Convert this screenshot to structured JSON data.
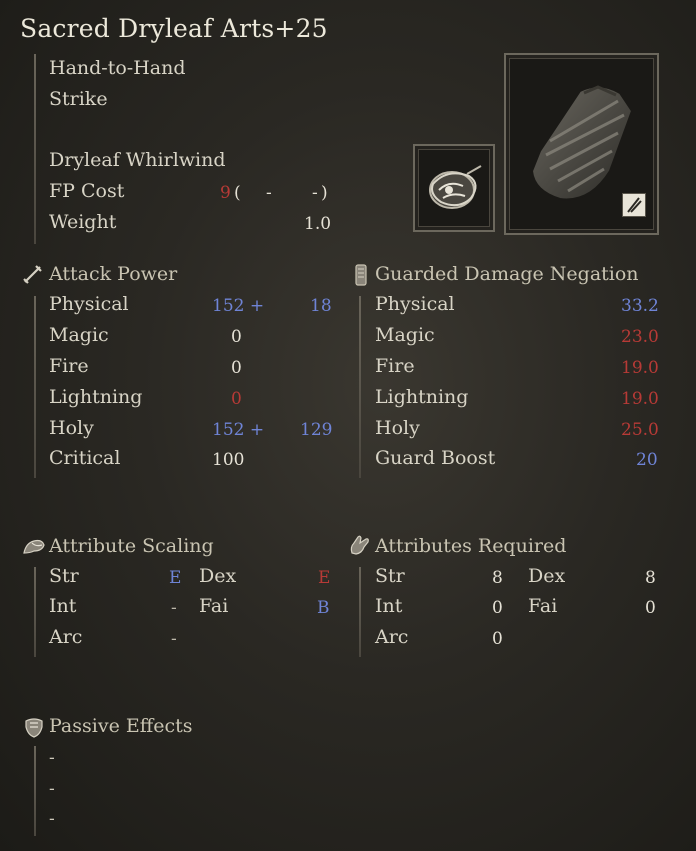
{
  "title": "Sacred Dryleaf Arts+25",
  "weapon": {
    "type": "Hand-to-Hand",
    "attack_type": "Strike",
    "skill": "Dryleaf Whirlwind",
    "fp_label": "FP Cost",
    "fp_value": "9",
    "fp_open": "(",
    "fp_dash1": "-",
    "fp_dash2": "-",
    "fp_close": ")",
    "weight_label": "Weight",
    "weight_value": "1.0"
  },
  "attack_power": {
    "header": "Attack Power",
    "rows": [
      {
        "label": "Physical",
        "base": "152 +",
        "bonus": "18"
      },
      {
        "label": "Magic",
        "base": "0",
        "bonus": ""
      },
      {
        "label": "Fire",
        "base": "0",
        "bonus": ""
      },
      {
        "label": "Lightning",
        "base": "0",
        "bonus": ""
      },
      {
        "label": "Holy",
        "base": "152 +",
        "bonus": "129"
      },
      {
        "label": "Critical",
        "base": "100",
        "bonus": ""
      }
    ]
  },
  "guard": {
    "header": "Guarded Damage Negation",
    "rows": [
      {
        "label": "Physical",
        "value": "33.2"
      },
      {
        "label": "Magic",
        "value": "23.0"
      },
      {
        "label": "Fire",
        "value": "19.0"
      },
      {
        "label": "Lightning",
        "value": "19.0"
      },
      {
        "label": "Holy",
        "value": "25.0"
      },
      {
        "label": "Guard Boost",
        "value": "20"
      }
    ]
  },
  "scaling": {
    "header": "Attribute Scaling",
    "str_label": "Str",
    "str_value": "E",
    "dex_label": "Dex",
    "dex_value": "E",
    "int_label": "Int",
    "int_value": "-",
    "fai_label": "Fai",
    "fai_value": "B",
    "arc_label": "Arc",
    "arc_value": "-"
  },
  "required": {
    "header": "Attributes Required",
    "str_label": "Str",
    "str_value": "8",
    "dex_label": "Dex",
    "dex_value": "8",
    "int_label": "Int",
    "int_value": "0",
    "fai_label": "Fai",
    "fai_value": "0",
    "arc_label": "Arc",
    "arc_value": "0"
  },
  "passive": {
    "header": "Passive Effects",
    "items": [
      "-",
      "-",
      "-"
    ]
  },
  "colors": {
    "blue": "#6f84d6",
    "red": "#b73a36"
  },
  "icons": {
    "attack_power": "sword-icon",
    "guard": "shield-icon",
    "scaling": "arm-icon",
    "required": "hand-icon",
    "passive": "armor-icon",
    "skill": "skill-ash-icon",
    "weapon": "wrapped-fist-icon",
    "affinity": "affinity-badge-icon"
  }
}
